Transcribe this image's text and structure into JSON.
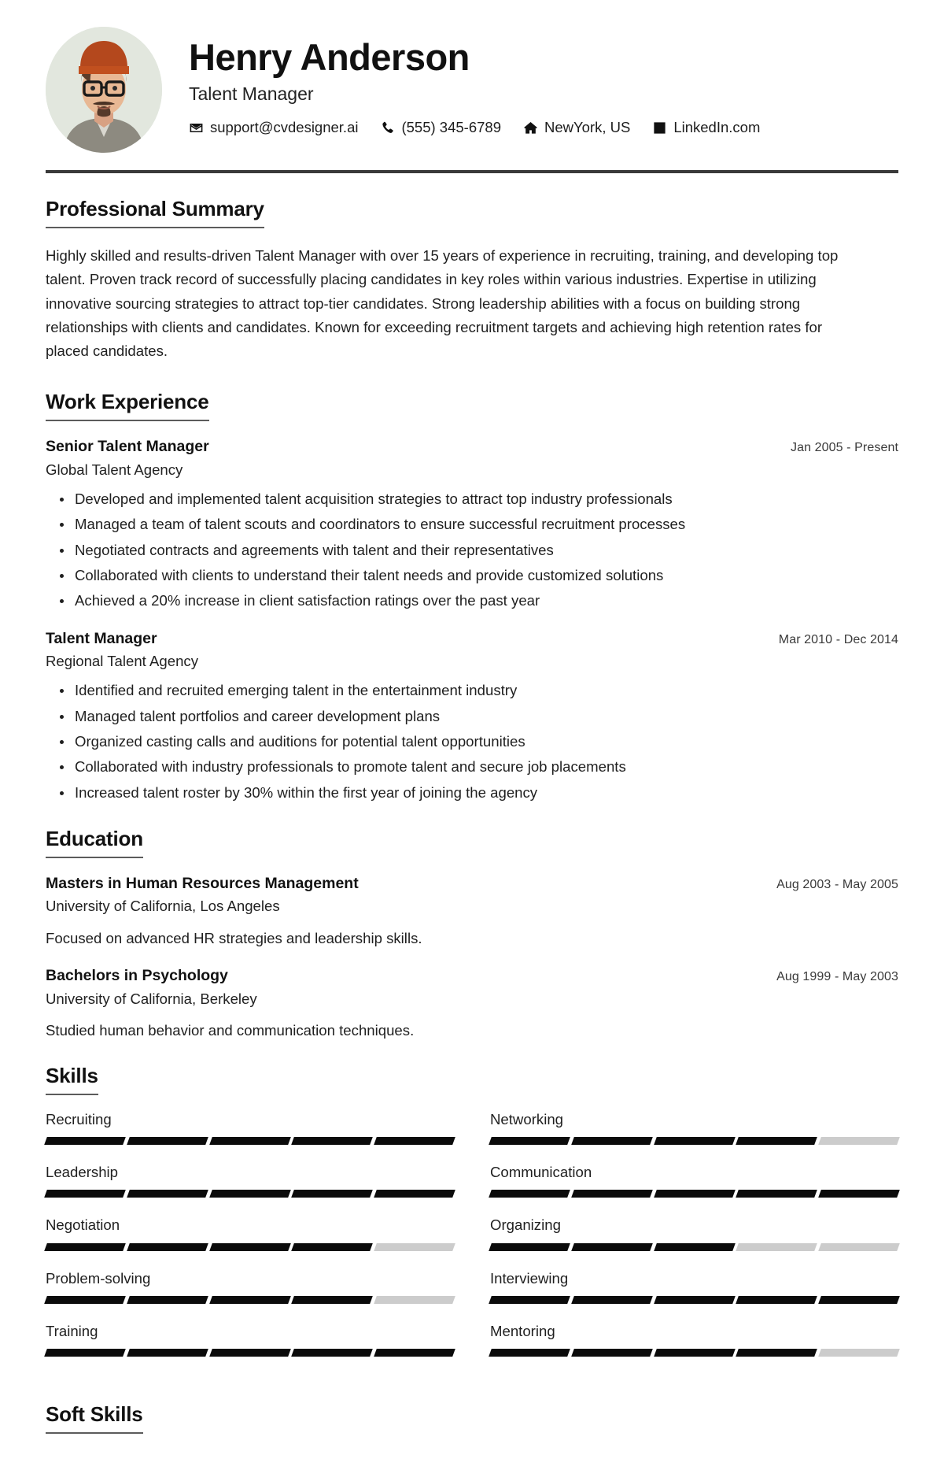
{
  "header": {
    "name": "Henry Anderson",
    "title": "Talent Manager",
    "avatar_name": "profile-photo",
    "contacts": [
      {
        "icon": "envelope-icon",
        "label": "support@cvdesigner.ai"
      },
      {
        "icon": "phone-icon",
        "label": "(555) 345-6789"
      },
      {
        "icon": "home-icon",
        "label": "NewYork, US"
      },
      {
        "icon": "linkedin-icon",
        "label": "LinkedIn.com"
      }
    ]
  },
  "summary": {
    "heading": "Professional Summary",
    "text": "Highly skilled and results-driven Talent Manager with over 15 years of experience in recruiting, training, and developing top talent. Proven track record of successfully placing candidates in key roles within various industries. Expertise in utilizing innovative sourcing strategies to attract top-tier candidates. Strong leadership abilities with a focus on building strong relationships with clients and candidates. Known for exceeding recruitment targets and achieving high retention rates for placed candidates."
  },
  "work": {
    "heading": "Work Experience",
    "entries": [
      {
        "role": "Senior Talent Manager",
        "org": "Global Talent Agency",
        "date": "Jan 2005 - Present",
        "bullets": [
          "Developed and implemented talent acquisition strategies to attract top industry professionals",
          "Managed a team of talent scouts and coordinators to ensure successful recruitment processes",
          "Negotiated contracts and agreements with talent and their representatives",
          "Collaborated with clients to understand their talent needs and provide customized solutions",
          "Achieved a 20% increase in client satisfaction ratings over the past year"
        ]
      },
      {
        "role": "Talent Manager",
        "org": "Regional Talent Agency",
        "date": "Mar 2010 - Dec 2014",
        "bullets": [
          "Identified and recruited emerging talent in the entertainment industry",
          "Managed talent portfolios and career development plans",
          "Organized casting calls and auditions for potential talent opportunities",
          "Collaborated with industry professionals to promote talent and secure job placements",
          "Increased talent roster by 30% within the first year of joining the agency"
        ]
      }
    ]
  },
  "education": {
    "heading": "Education",
    "entries": [
      {
        "degree": "Masters in Human Resources Management",
        "school": "University of California, Los Angeles",
        "date": "Aug 2003 - May 2005",
        "desc": "Focused on advanced HR strategies and leadership skills."
      },
      {
        "degree": "Bachelors in Psychology",
        "school": "University of California, Berkeley",
        "date": "Aug 1999 - May 2003",
        "desc": "Studied human behavior and communication techniques."
      }
    ]
  },
  "skills": {
    "heading": "Skills",
    "max_level": 5,
    "items": [
      {
        "name": "Recruiting",
        "level": 5
      },
      {
        "name": "Networking",
        "level": 4
      },
      {
        "name": "Leadership",
        "level": 5
      },
      {
        "name": "Communication",
        "level": 5
      },
      {
        "name": "Negotiation",
        "level": 4
      },
      {
        "name": "Organizing",
        "level": 3
      },
      {
        "name": "Problem-solving",
        "level": 4
      },
      {
        "name": "Interviewing",
        "level": 5
      },
      {
        "name": "Training",
        "level": 5
      },
      {
        "name": "Mentoring",
        "level": 4
      }
    ]
  },
  "soft_skills": {
    "heading": "Soft Skills"
  },
  "colors": {
    "text": "#1f1f1f",
    "rule": "#3a3a3a",
    "bar_filled": "#0b0b0b",
    "bar_empty": "#cccccc"
  }
}
